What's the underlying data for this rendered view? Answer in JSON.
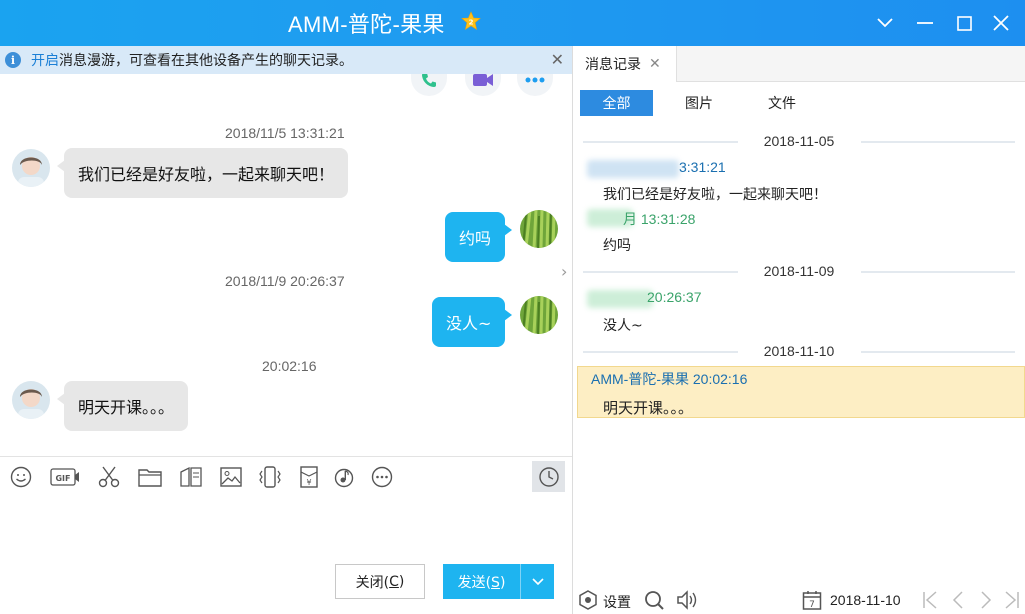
{
  "window": {
    "title": "AMM-普陀-果果",
    "vip_badge": "2"
  },
  "notice": {
    "link": "开启",
    "text": "消息漫游，可查看在其他设备产生的聊天记录。"
  },
  "chat": {
    "messages": [
      {
        "time": "2018/11/5 13:31:21",
        "text": "我们已经是好友啦，一起来聊天吧！",
        "dir": "in"
      },
      {
        "text": "约吗",
        "dir": "out"
      },
      {
        "time": "2018/11/9 20:26:37",
        "text": "没人~",
        "dir": "out"
      },
      {
        "time": "20:02:16",
        "text": "明天开课。。。",
        "dir": "in"
      }
    ]
  },
  "buttons": {
    "close": "关闭(",
    "close_key": "C",
    "close_end": ")",
    "send": "发送(",
    "send_key": "S",
    "send_end": ")"
  },
  "history": {
    "tab_label": "消息记录",
    "filters": [
      "全部",
      "图片",
      "文件"
    ],
    "groups": [
      {
        "date": "2018-11-05",
        "records": [
          {
            "name": "3:31:21",
            "text": "我们已经是好友啦，一起来聊天吧！"
          },
          {
            "name": "月 13:31:28",
            "text": "约吗"
          }
        ]
      },
      {
        "date": "2018-11-09",
        "records": [
          {
            "name": " 20:26:37",
            "text": "没人~"
          }
        ]
      },
      {
        "date": "2018-11-10",
        "records": [
          {
            "name": "AMM-普陀-果果 20:02:16",
            "text": "明天开课。。。"
          }
        ]
      }
    ],
    "footer": {
      "settings": "设置",
      "calendar_day": "7",
      "date": "2018-11-10"
    }
  },
  "colors": {
    "accent": "#1eb4f0",
    "tab_active": "#2d8be0",
    "peer_name": "#1a6fb0",
    "self_name": "#3aa36a",
    "highlight": "#fdeec4"
  }
}
